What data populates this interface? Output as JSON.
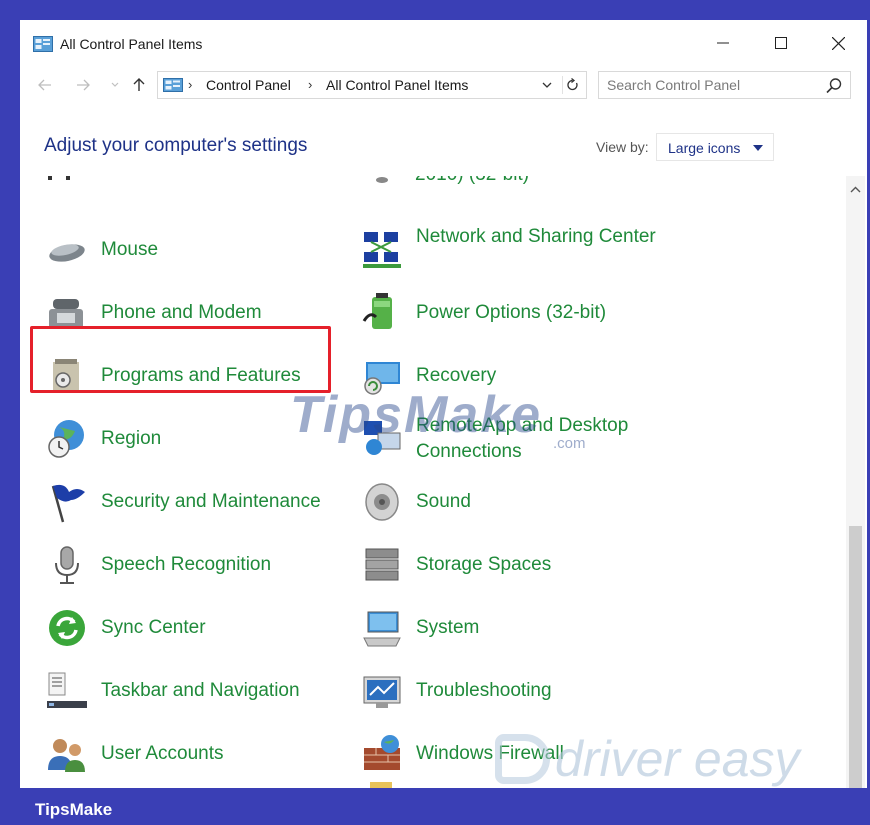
{
  "window": {
    "title": "All Control Panel Items",
    "minimize_icon": "minimize-icon",
    "maximize_icon": "maximize-icon",
    "close_icon": "close-icon"
  },
  "address": {
    "crumbs": [
      "Control Panel",
      "All Control Panel Items"
    ],
    "search_placeholder": "Search Control Panel"
  },
  "header": {
    "title": "Adjust your computer's settings",
    "view_by_label": "View by:",
    "view_by_value": "Large icons"
  },
  "items": {
    "partial_top_right": "2010) (32-bit)",
    "mouse": "Mouse",
    "network": "Network and Sharing Center",
    "phone": "Phone and Modem",
    "power": "Power Options (32-bit)",
    "programs": "Programs and Features",
    "recovery": "Recovery",
    "region": "Region",
    "remoteapp": "RemoteApp and Desktop Connections",
    "security": "Security and Maintenance",
    "sound": "Sound",
    "speech": "Speech Recognition",
    "storage": "Storage Spaces",
    "sync": "Sync Center",
    "system": "System",
    "taskbar": "Taskbar and Navigation",
    "troubleshooting": "Troubleshooting",
    "users": "User Accounts",
    "firewall": "Windows Firewall"
  },
  "watermarks": {
    "tipsmake": "TipsMake",
    "tipsmake_suffix": ".com",
    "drivereasy": "driver easy"
  },
  "footer": {
    "label": "TipsMake"
  },
  "colors": {
    "frame": "#3a3fb5",
    "link_green": "#1f8a3a",
    "heading_blue": "#1e3287",
    "highlight_red": "#e5202a"
  }
}
